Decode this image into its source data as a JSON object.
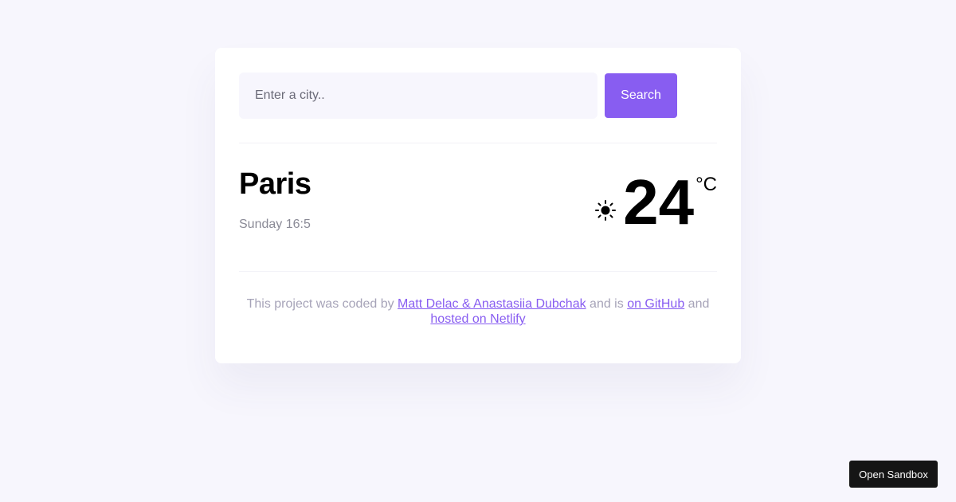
{
  "search": {
    "placeholder": "Enter a city..",
    "value": "",
    "button_label": "Search"
  },
  "weather": {
    "city": "Paris",
    "details": "Sunday 16:5",
    "icon": "sun-icon",
    "temperature": "24",
    "unit": "°C"
  },
  "footer": {
    "text_prefix": "This project was coded by ",
    "authors_link": "Matt Delac & Anastasiia Dubchak",
    "text_middle": " and is ",
    "github_link": "on GitHub",
    "text_and": " and ",
    "netlify_link": "hosted on Netlify"
  },
  "sandbox": {
    "button_label": "Open Sandbox"
  },
  "colors": {
    "accent": "#885df1",
    "background": "#f7f6fd",
    "card": "#ffffff",
    "muted_text": "#8a8a96"
  }
}
